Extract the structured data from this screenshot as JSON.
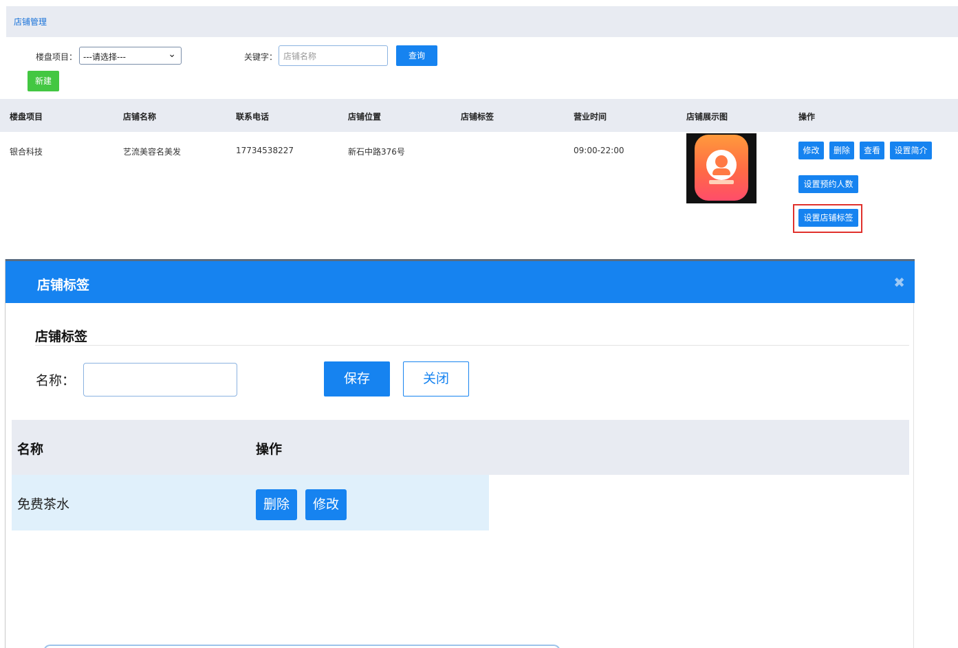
{
  "page": {
    "breadcrumb": "店铺管理",
    "filters": {
      "project_label": "楼盘项目：",
      "project_select": "---请选择---",
      "keyword_label": "关键字：",
      "keyword_placeholder": "店铺名称",
      "query_button": "查询",
      "new_button": "新建"
    },
    "table": {
      "headers": [
        "楼盘项目",
        "店铺名称",
        "联系电话",
        "店铺位置",
        "店铺标签",
        "营业时间",
        "店铺展示图",
        "操作"
      ],
      "rows": [
        {
          "project": "银合科技",
          "name": "艺流美容名美发",
          "phone": "17734538227",
          "location": "新石中路376号",
          "tags": "",
          "hours": "09:00-22:00",
          "actions": [
            "修改",
            "删除",
            "查看",
            "设置简介",
            "设置预约人数",
            "设置店铺标签"
          ]
        }
      ]
    }
  },
  "modal": {
    "title": "店铺标签",
    "close_icon": "close-icon",
    "section_title": "店铺标签",
    "name_label": "名称：",
    "name_value": "",
    "save_button": "保存",
    "close_button": "关闭",
    "tag_table": {
      "headers": [
        "名称",
        "操作"
      ],
      "rows": [
        {
          "name": "免费茶水",
          "delete": "删除",
          "edit": "修改"
        }
      ]
    }
  },
  "colors": {
    "primary": "#1683f0",
    "success": "#43c742",
    "highlight": "#e0302b",
    "header_bg": "#e8ebf2",
    "row_highlight": "#e0f0fb"
  }
}
